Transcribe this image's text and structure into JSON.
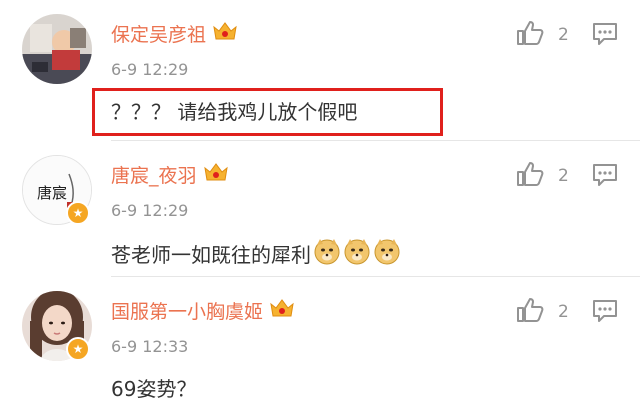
{
  "colors": {
    "username": "#eb7350",
    "meta": "#939393",
    "text": "#333333",
    "highlight": "#e0201c",
    "badge": "#f5a623"
  },
  "comments": [
    {
      "username": "保定吴彦祖",
      "timestamp": "6-9 12:29",
      "text": "？？？ 请给我鸡儿放个假吧",
      "likes": "2",
      "highlighted": true,
      "avatar_text": "",
      "verified": false,
      "emoji_count": 0
    },
    {
      "username": "唐宸_夜羽",
      "timestamp": "6-9 12:29",
      "text": "苍老师一如既往的犀利",
      "likes": "2",
      "highlighted": false,
      "avatar_text": "唐宸",
      "verified": true,
      "emoji_count": 3
    },
    {
      "username": "国服第一小胸虞姬",
      "timestamp": "6-9 12:33",
      "text": "69姿势？",
      "likes": "2",
      "highlighted": false,
      "avatar_text": "",
      "verified": true,
      "emoji_count": 0
    }
  ],
  "icons": {
    "like": "thumbs-up-icon",
    "reply": "comment-reply-icon",
    "vip": "vip-crown-icon",
    "emoji": "doge-emoji-icon"
  }
}
